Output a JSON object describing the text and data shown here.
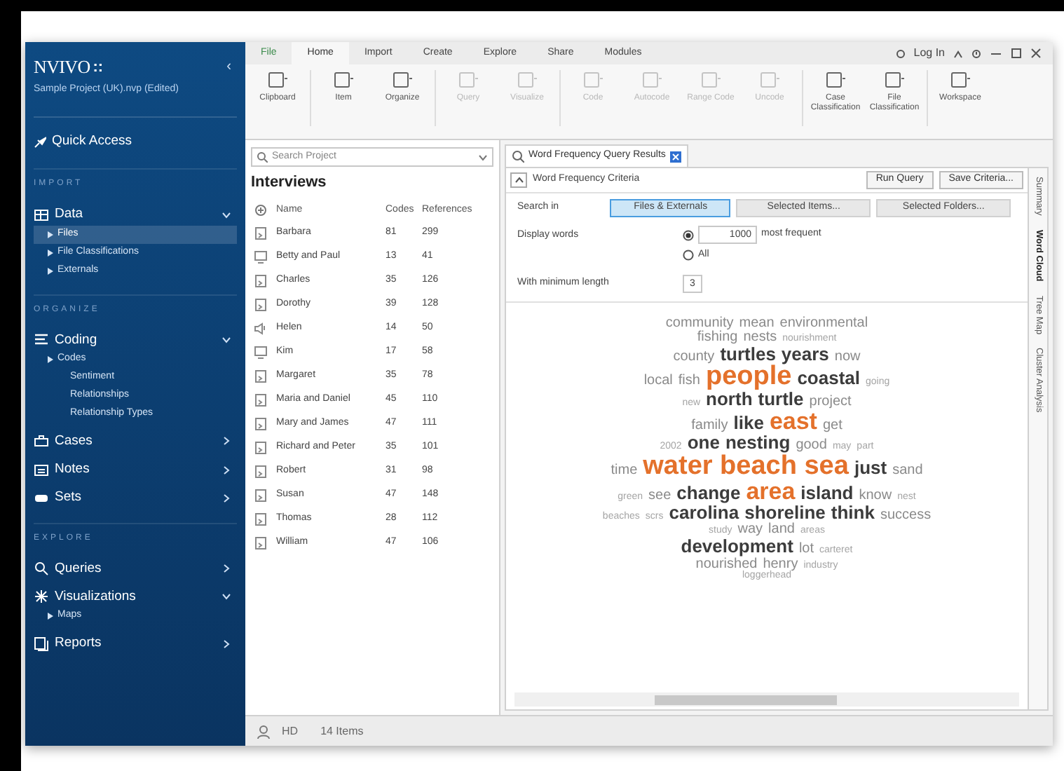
{
  "sidebar": {
    "logo": "NVIVO",
    "logo_mark": "::",
    "collapse": "‹",
    "project": "Sample Project (UK).nvp (Edited)",
    "sections": [
      {
        "kind": "link",
        "label": "Quick Access"
      },
      {
        "kind": "heading",
        "label": "IMPORT"
      },
      {
        "kind": "group",
        "label": "Data",
        "expanded": true,
        "children": [
          {
            "label": "Files",
            "selected": true
          },
          {
            "label": "File Classifications",
            "selected": false
          },
          {
            "label": "Externals",
            "selected": false
          }
        ]
      },
      {
        "kind": "heading",
        "label": "ORGANIZE"
      },
      {
        "kind": "group",
        "label": "Coding",
        "expanded": true,
        "children": [
          {
            "label": "Codes",
            "selected": false,
            "children": [
              {
                "label": "Sentiment",
                "selected": false
              },
              {
                "label": "Relationships",
                "selected": false
              },
              {
                "label": "Relationship Types",
                "selected": false
              }
            ]
          }
        ]
      },
      {
        "kind": "group",
        "label": "Cases",
        "expanded": false
      },
      {
        "kind": "group",
        "label": "Notes",
        "expanded": false
      },
      {
        "kind": "group",
        "label": "Sets",
        "expanded": false
      },
      {
        "kind": "heading",
        "label": "EXPLORE"
      },
      {
        "kind": "group",
        "label": "Queries",
        "expanded": false
      },
      {
        "kind": "group",
        "label": "Visualizations",
        "expanded": true,
        "children": [
          {
            "label": "Maps",
            "selected": false
          }
        ]
      },
      {
        "kind": "group",
        "label": "Reports",
        "expanded": false
      }
    ]
  },
  "ribbon": {
    "tabs": [
      {
        "label": "File",
        "selected": false
      },
      {
        "label": "Home",
        "selected": true
      },
      {
        "label": "Import",
        "selected": false
      },
      {
        "label": "Create",
        "selected": false
      },
      {
        "label": "Explore",
        "selected": false
      },
      {
        "label": "Share",
        "selected": false
      },
      {
        "label": "Modules",
        "selected": false
      }
    ],
    "login": "Log In",
    "groups": [
      {
        "label": "Clipboard",
        "disabled": false
      },
      {
        "label": "Item",
        "disabled": false
      },
      {
        "label": "Organize",
        "disabled": false
      },
      {
        "label": "Query",
        "disabled": true
      },
      {
        "label": "Visualize",
        "disabled": true
      },
      {
        "label": "Code",
        "disabled": true
      },
      {
        "label": "Autocode",
        "disabled": true
      },
      {
        "label": "Range Code",
        "disabled": true
      },
      {
        "label": "Uncode",
        "disabled": true
      },
      {
        "label": "Case Classification",
        "disabled": false
      },
      {
        "label": "File Classification",
        "disabled": false
      },
      {
        "label": "Workspace",
        "disabled": false
      }
    ]
  },
  "list_view": {
    "search": {
      "placeholder": "Search Project"
    },
    "title": "Interviews",
    "columns": [
      "Name",
      "Codes",
      "References"
    ],
    "rows": [
      {
        "kind": "document",
        "name": "Barbara",
        "codes": "81",
        "references": "299"
      },
      {
        "kind": "video",
        "name": "Betty and Paul",
        "codes": "13",
        "references": "41"
      },
      {
        "kind": "document",
        "name": "Charles",
        "codes": "35",
        "references": "126"
      },
      {
        "kind": "document",
        "name": "Dorothy",
        "codes": "39",
        "references": "128"
      },
      {
        "kind": "audio",
        "name": "Helen",
        "codes": "14",
        "references": "50"
      },
      {
        "kind": "video",
        "name": "Kim",
        "codes": "17",
        "references": "58"
      },
      {
        "kind": "document",
        "name": "Margaret",
        "codes": "35",
        "references": "78"
      },
      {
        "kind": "document",
        "name": "Maria and Daniel",
        "codes": "45",
        "references": "110"
      },
      {
        "kind": "document",
        "name": "Mary and James",
        "codes": "47",
        "references": "111"
      },
      {
        "kind": "document",
        "name": "Richard and Peter",
        "codes": "35",
        "references": "101"
      },
      {
        "kind": "document",
        "name": "Robert",
        "codes": "31",
        "references": "98"
      },
      {
        "kind": "document",
        "name": "Susan",
        "codes": "47",
        "references": "148"
      },
      {
        "kind": "document",
        "name": "Thomas",
        "codes": "28",
        "references": "112"
      },
      {
        "kind": "document",
        "name": "William",
        "codes": "47",
        "references": "106"
      }
    ]
  },
  "query": {
    "tab": "Word Frequency Query Results",
    "criteria_title": "Word Frequency Criteria",
    "expanded": true,
    "buttons": [
      "Run Query",
      "Save Criteria..."
    ],
    "search_in_label": "Search in",
    "search_in": [
      {
        "label": "Files & Externals",
        "selected": true
      },
      {
        "label": "Selected Items...",
        "selected": false
      },
      {
        "label": "Selected Folders...",
        "selected": false
      }
    ],
    "display_label": "Display words",
    "display_options": [
      {
        "label": "most frequent",
        "value": "1000",
        "selected": true
      },
      {
        "label": "All",
        "selected": false
      }
    ],
    "min_length_label": "With minimum length",
    "min_length": "3",
    "view_tabs": [
      {
        "label": "Summary",
        "selected": false
      },
      {
        "label": "Word Cloud",
        "selected": true
      },
      {
        "label": "Tree Map",
        "selected": false
      },
      {
        "label": "Cluster Analysis",
        "selected": false
      }
    ],
    "cloud": [
      [
        {
          "w": "community",
          "kind": "mid"
        },
        {
          "w": "mean",
          "kind": "mid"
        },
        {
          "w": "environmental",
          "kind": "mid"
        }
      ],
      [
        {
          "w": "fishing",
          "kind": "mid"
        },
        {
          "w": "nests",
          "kind": "mid"
        },
        {
          "w": "nourishment",
          "kind": "minor"
        }
      ],
      [
        {
          "w": "county",
          "kind": "mid"
        },
        {
          "w": "turtles",
          "kind": "major"
        },
        {
          "w": "years",
          "kind": "major"
        },
        {
          "w": "now",
          "kind": "mid"
        }
      ],
      [
        {
          "w": "local",
          "kind": "mid"
        },
        {
          "w": "fish",
          "kind": "mid"
        },
        {
          "w": "people",
          "kind": "peak"
        },
        {
          "w": "coastal",
          "kind": "major"
        },
        {
          "w": "going",
          "kind": "minor"
        }
      ],
      [
        {
          "w": "new",
          "kind": "minor"
        },
        {
          "w": "north",
          "kind": "major"
        },
        {
          "w": "turtle",
          "kind": "major"
        },
        {
          "w": "project",
          "kind": "mid"
        }
      ],
      [
        {
          "w": "family",
          "kind": "mid"
        },
        {
          "w": "like",
          "kind": "major"
        },
        {
          "w": "east",
          "kind": "top"
        },
        {
          "w": "get",
          "kind": "mid"
        }
      ],
      [
        {
          "w": "2002",
          "kind": "minor"
        },
        {
          "w": "one",
          "kind": "major"
        },
        {
          "w": "nesting",
          "kind": "major"
        },
        {
          "w": "good",
          "kind": "mid"
        },
        {
          "w": "may",
          "kind": "minor"
        },
        {
          "w": "part",
          "kind": "minor"
        }
      ],
      [
        {
          "w": "time",
          "kind": "mid"
        },
        {
          "w": "water beach sea",
          "kind": "peak"
        },
        {
          "w": "just",
          "kind": "major"
        },
        {
          "w": "sand",
          "kind": "mid"
        }
      ],
      [
        {
          "w": "green",
          "kind": "minor"
        },
        {
          "w": "see",
          "kind": "mid"
        },
        {
          "w": "change",
          "kind": "major"
        },
        {
          "w": "area",
          "kind": "top"
        },
        {
          "w": "island",
          "kind": "major"
        },
        {
          "w": "know",
          "kind": "mid"
        },
        {
          "w": "nest",
          "kind": "minor"
        }
      ],
      [
        {
          "w": "beaches",
          "kind": "minor"
        },
        {
          "w": "scrs",
          "kind": "minor"
        },
        {
          "w": "carolina",
          "kind": "major"
        },
        {
          "w": "shoreline",
          "kind": "major"
        },
        {
          "w": "think",
          "kind": "major"
        },
        {
          "w": "success",
          "kind": "mid"
        }
      ],
      [
        {
          "w": "study",
          "kind": "minor"
        },
        {
          "w": "way",
          "kind": "mid"
        },
        {
          "w": "land",
          "kind": "mid"
        },
        {
          "w": "areas",
          "kind": "minor"
        }
      ],
      [
        {
          "w": "development",
          "kind": "major"
        },
        {
          "w": "lot",
          "kind": "mid"
        },
        {
          "w": "carteret",
          "kind": "minor"
        }
      ],
      [
        {
          "w": "nourished",
          "kind": "mid"
        },
        {
          "w": "henry",
          "kind": "mid"
        },
        {
          "w": "industry",
          "kind": "minor"
        }
      ],
      [
        {
          "w": "loggerhead",
          "kind": "minor"
        }
      ]
    ]
  },
  "status_bar": {
    "user": "HD",
    "items": "14 Items"
  }
}
